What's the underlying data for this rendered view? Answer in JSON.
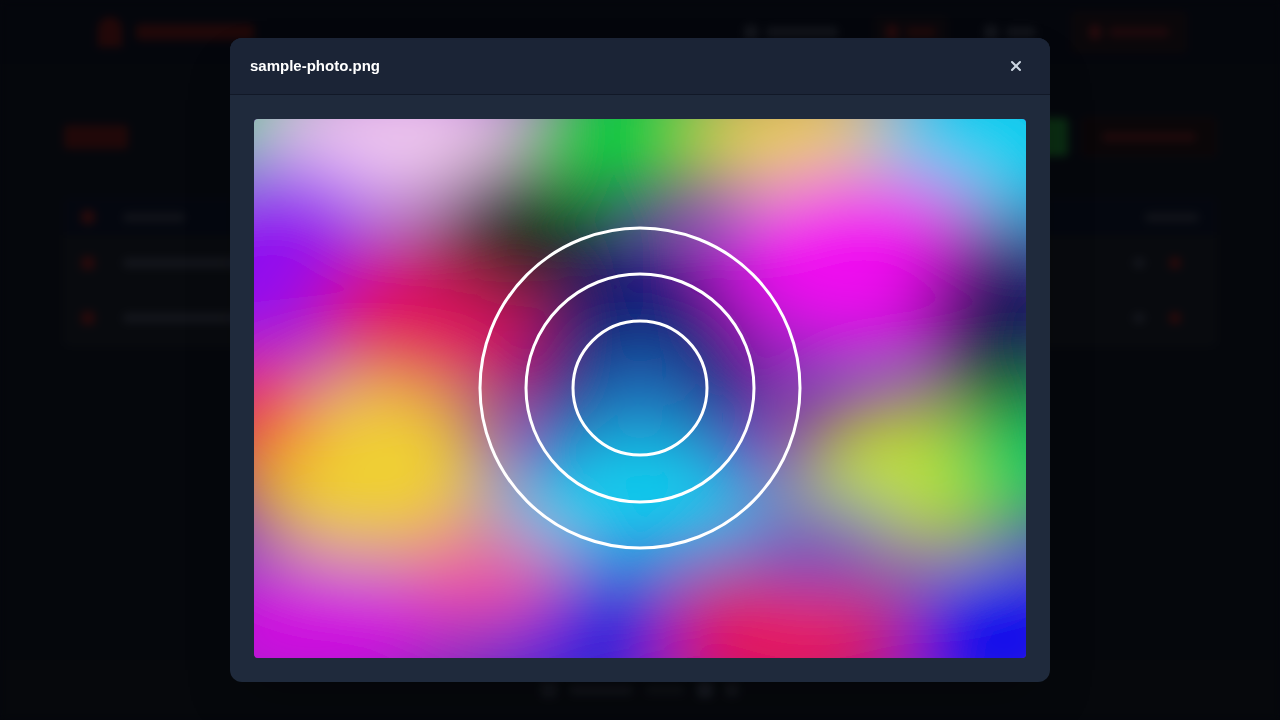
{
  "dialog": {
    "title": "sample-photo.png"
  }
}
